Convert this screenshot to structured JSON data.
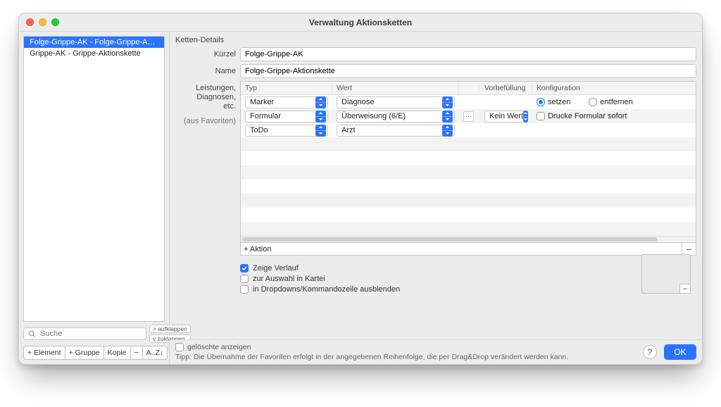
{
  "window": {
    "title": "Verwaltung Aktionsketten"
  },
  "sidebar": {
    "items": [
      {
        "label": "Folge-Grippe-AK - Folge-Grippe-Akt...",
        "selected": true
      },
      {
        "label": "Grippe-AK - Grippe-Aktionskette",
        "selected": false
      }
    ],
    "search_placeholder": "Suche",
    "expand": "> aufklappen",
    "collapse": "v zuklappen",
    "buttons": {
      "add_element": "+ Element",
      "add_group": "+ Gruppe",
      "copy": "Kopie",
      "remove": "−",
      "sort": "A..Z↓"
    }
  },
  "details": {
    "section": "Ketten-Details",
    "labels": {
      "kuerzel": "Kürzel",
      "name": "Name",
      "leist": "Leistungen,\nDiagnosen,\netc.",
      "fav": "(aus Favoriten)"
    },
    "kuerzel_value": "Folge-Grippe-AK",
    "name_value": "Folge-Grippe-Aktionskette",
    "columns": {
      "typ": "Typ",
      "wert": "Wert",
      "vorb": "Vorbefüllung",
      "konfig": "Konfiguration"
    },
    "rows": [
      {
        "typ": "Marker",
        "wert": "Diagnose",
        "extra": null,
        "vorb": "",
        "konfig": {
          "kind": "radio-pair",
          "opt1": "setzen",
          "opt2": "entfernen",
          "selected": 0
        }
      },
      {
        "typ": "Formular",
        "wert": "Überweisung (6/E)",
        "extra": "ellipsis",
        "vorb": "Kein Wert",
        "konfig": {
          "kind": "check",
          "label": "Drucke Formular sofort",
          "checked": false
        }
      },
      {
        "typ": "ToDo",
        "wert": "Arzt",
        "extra": null,
        "vorb": "",
        "konfig": {
          "kind": "none"
        }
      }
    ],
    "add_action": "+ Aktion",
    "checks": {
      "verlauf": {
        "label": "Zeige Verlauf",
        "checked": true
      },
      "kartei": {
        "label": "zur Auswahl in Kartei",
        "checked": false
      },
      "dropdown": {
        "label": "in Dropdowns/Kommandozeile ausblenden",
        "checked": false
      }
    }
  },
  "footer": {
    "show_deleted": {
      "label": "gelöschte anzeigen",
      "checked": false
    },
    "hint": "Tipp: Die Übernahme der Favoriten erfolgt in der angegebenen Reihenfolge, die per Drag&Drop verändert werden kann.",
    "help": "?",
    "ok": "OK"
  }
}
